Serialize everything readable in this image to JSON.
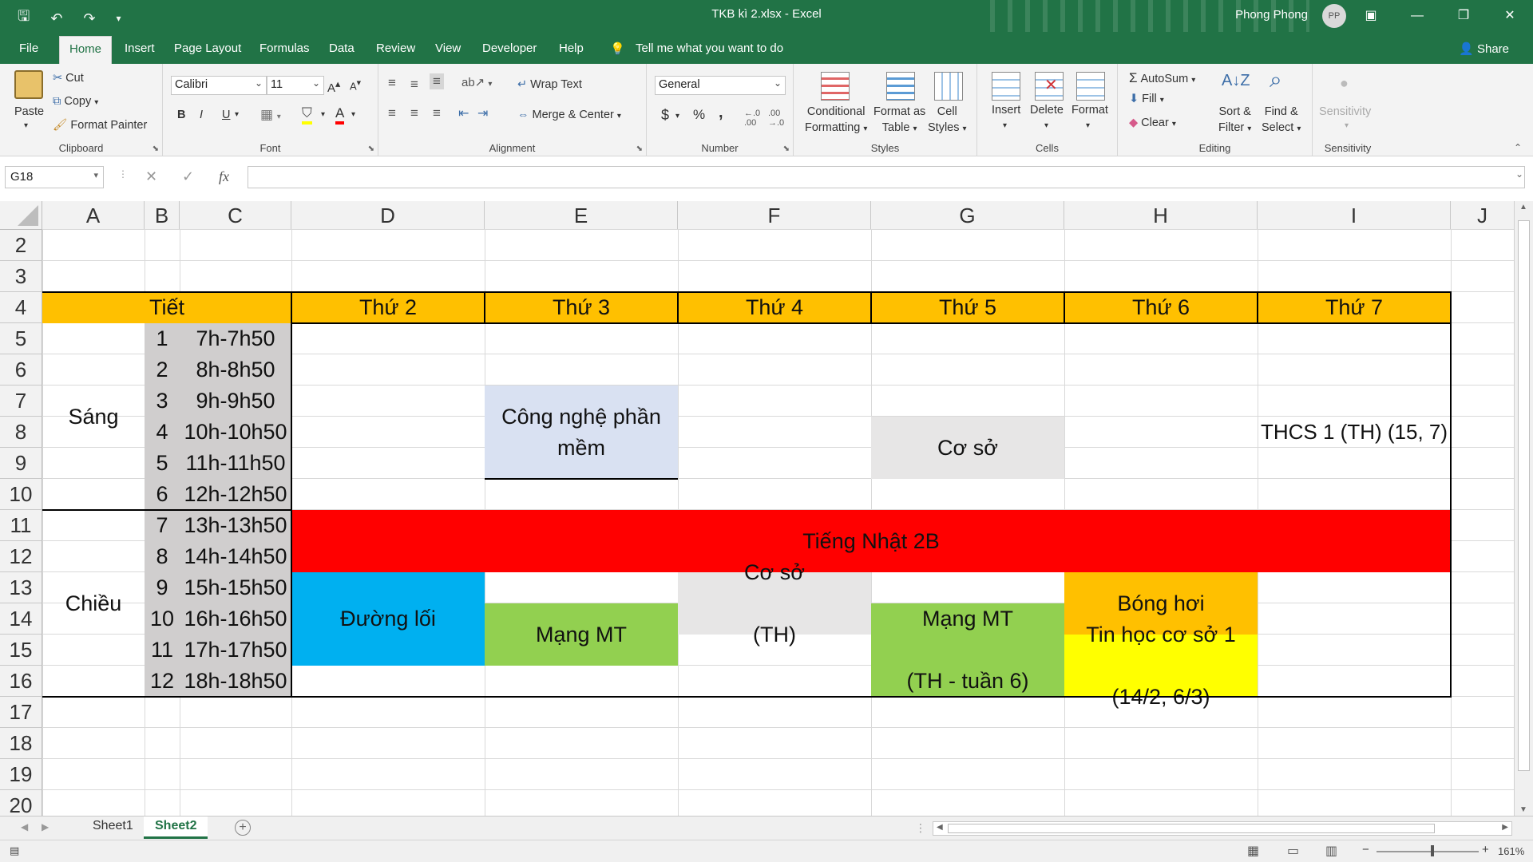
{
  "window": {
    "title": "TKB kì 2.xlsx  -  Excel",
    "user_name": "Phong Phong",
    "user_initials": "PP"
  },
  "menu": {
    "file": "File",
    "home": "Home",
    "insert": "Insert",
    "page_layout": "Page Layout",
    "formulas": "Formulas",
    "data": "Data",
    "review": "Review",
    "view": "View",
    "developer": "Developer",
    "help": "Help",
    "tell_me": "Tell me what you want to do",
    "share": "Share"
  },
  "ribbon": {
    "clipboard": {
      "label": "Clipboard",
      "paste": "Paste",
      "cut": "Cut",
      "copy": "Copy",
      "format_painter": "Format Painter"
    },
    "font": {
      "label": "Font",
      "name": "Calibri",
      "size": "11",
      "bold": "B",
      "italic": "I",
      "underline": "U"
    },
    "alignment": {
      "label": "Alignment",
      "wrap_text": "Wrap Text",
      "merge_center": "Merge & Center"
    },
    "number": {
      "label": "Number",
      "format": "General",
      "currency": "$",
      "percent": "%",
      "comma": ","
    },
    "styles": {
      "label": "Styles",
      "conditional_1": "Conditional",
      "conditional_2": "Formatting",
      "format_as_1": "Format as",
      "format_as_2": "Table",
      "cell_1": "Cell",
      "cell_2": "Styles"
    },
    "cells": {
      "label": "Cells",
      "insert": "Insert",
      "delete": "Delete",
      "format": "Format"
    },
    "editing": {
      "label": "Editing",
      "autosum": "AutoSum",
      "fill": "Fill",
      "clear": "Clear",
      "sort_1": "Sort &",
      "sort_2": "Filter",
      "find_1": "Find &",
      "find_2": "Select"
    },
    "sensitivity": {
      "label": "Sensitivity",
      "button": "Sensitivity"
    }
  },
  "formula_bar": {
    "name_box": "G18",
    "fx": "fx",
    "content": ""
  },
  "columns": [
    "A",
    "B",
    "C",
    "D",
    "E",
    "F",
    "G",
    "H",
    "I",
    "J"
  ],
  "rows": [
    "2",
    "3",
    "4",
    "5",
    "6",
    "7",
    "8",
    "9",
    "10",
    "11",
    "12",
    "13",
    "14",
    "15",
    "16",
    "17",
    "18",
    "19",
    "20"
  ],
  "sheet": {
    "header_tiet": "Tiết",
    "days": [
      "Thứ 2",
      "Thứ 3",
      "Thứ 4",
      "Thứ 5",
      "Thứ 6",
      "Thứ 7"
    ],
    "sang": "Sáng",
    "chieu": "Chiều",
    "periods": [
      "1",
      "2",
      "3",
      "4",
      "5",
      "6",
      "7",
      "8",
      "9",
      "10",
      "11",
      "12"
    ],
    "times": [
      "7h-7h50",
      "8h-8h50",
      "9h-9h50",
      "10h-10h50",
      "11h-11h50",
      "12h-12h50",
      "13h-13h50",
      "14h-14h50",
      "15h-15h50",
      "16h-16h50",
      "17h-17h50",
      "18h-18h50"
    ],
    "cong_nghe_phan_mem": "Công nghệ phần mềm",
    "co_so": "Cơ sở",
    "thcs": "THCS 1 (TH) (15, 7)",
    "tieng_nhat": "Tiếng Nhật 2B",
    "duong_loi": "Đường lối",
    "mang_mt_e": "Mạng MT",
    "co_so_th_1": "Cơ sở",
    "co_so_th_2": "(TH)",
    "mang_mt_g_1": "Mạng MT",
    "mang_mt_g_2": "(TH - tuần 6)",
    "bong_hoi": "Bóng hơi",
    "tin_hoc_1": "Tin học cơ sở 1",
    "tin_hoc_2": "(14/2, 6/3)"
  },
  "colors": {
    "excel_green": "#217346",
    "header_orange": "#ffc000",
    "light_blue": "#d9e1f2",
    "light_gray": "#e7e6e6",
    "period_gray": "#d0cece",
    "red": "#ff0000",
    "cyan_blue": "#00b0f0",
    "green": "#92d050",
    "orange": "#ffc000",
    "yellow": "#ffff00"
  },
  "sheet_tabs": [
    "Sheet1",
    "Sheet2"
  ],
  "status": {
    "zoom": "161%"
  }
}
